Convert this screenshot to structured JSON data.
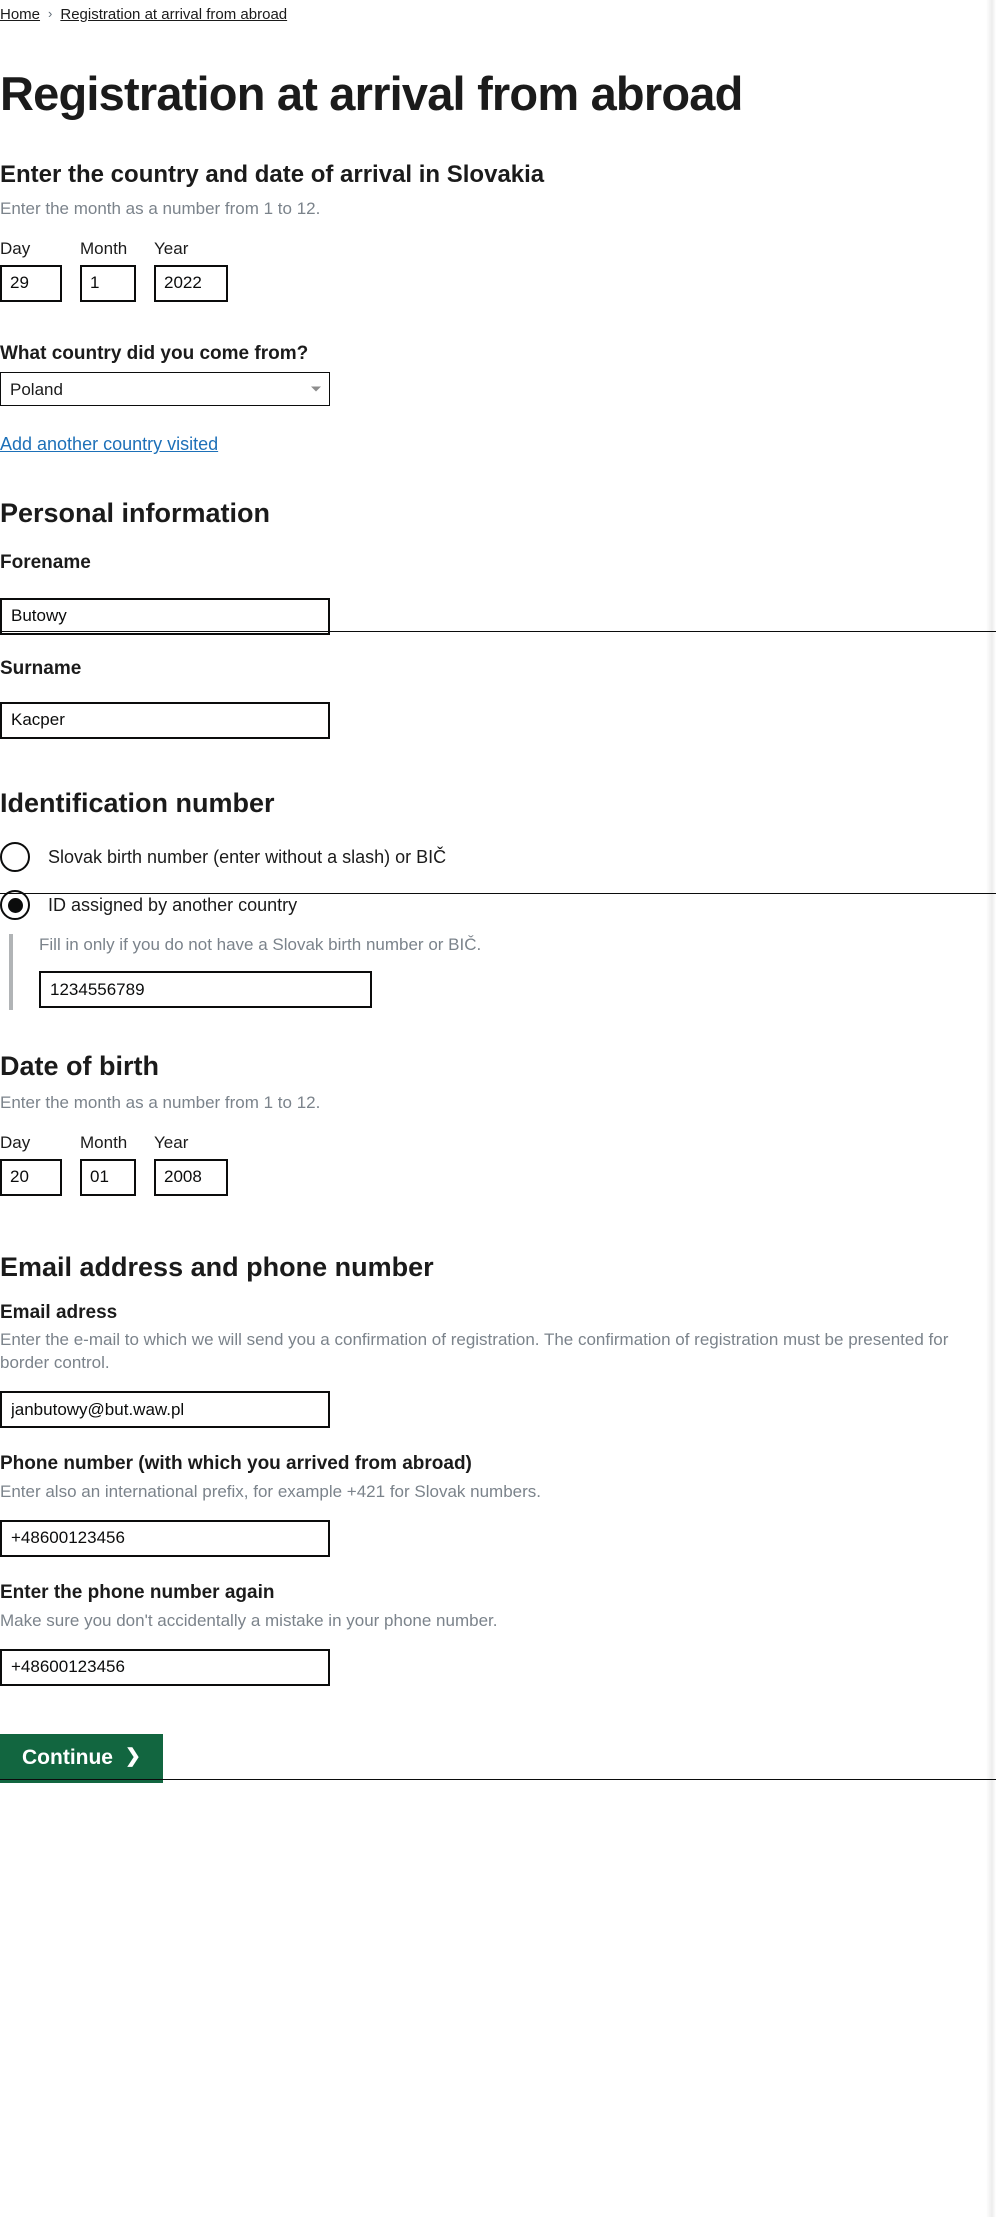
{
  "breadcrumb": {
    "home": "Home",
    "separator": "›",
    "current": "Registration at arrival from abroad"
  },
  "page_title": "Registration at arrival from abroad",
  "arrival": {
    "section_title": "Enter the country and date of arrival in Slovakia",
    "hint": "Enter the month as a number from 1 to 12.",
    "day_label": "Day",
    "month_label": "Month",
    "year_label": "Year",
    "day_value": "29",
    "month_value": "1",
    "year_value": "2022",
    "country_label": "What country did you come from?",
    "country_value": "Poland",
    "country_options": [
      "Poland"
    ],
    "add_country_link": "Add another country visited"
  },
  "personal": {
    "section_title": "Personal information",
    "forename_label": "Forename",
    "forename_value": "Butowy",
    "surname_label": "Surname",
    "surname_value": "Kacper"
  },
  "identification": {
    "section_title": "Identification number",
    "option_slovak": "Slovak birth number (enter without a slash) or BIČ",
    "option_foreign": "ID assigned by another country",
    "selected": "foreign",
    "conditional_hint": "Fill in only if you do not have a Slovak birth number or BIČ.",
    "id_value": "1234556789"
  },
  "date_of_birth": {
    "section_title": "Date of birth",
    "hint": "Enter the month as a number from 1 to 12.",
    "day_label": "Day",
    "month_label": "Month",
    "year_label": "Year",
    "day_value": "20",
    "month_value": "01",
    "year_value": "2008"
  },
  "contact": {
    "section_title": "Email address and phone number",
    "email_label": "Email adress",
    "email_hint": "Enter the e-mail to which we will send you a confirmation of registration. The confirmation of registration must be presented for border control.",
    "email_value": "janbutowy@but.waw.pl",
    "phone_label": "Phone number (with which you arrived from abroad)",
    "phone_hint": "Enter also an international prefix, for example +421 for Slovak numbers.",
    "phone_value": "+48600123456",
    "phone_confirm_label": "Enter the phone number again",
    "phone_confirm_hint": "Make sure you don't accidentally a mistake in your phone number.",
    "phone_confirm_value": "+48600123456"
  },
  "footer": {
    "continue_label": "Continue",
    "continue_chevron": "❯"
  },
  "colors": {
    "button_green": "#126640",
    "link_blue": "#1d70b8",
    "hint_grey": "#7b838b"
  }
}
